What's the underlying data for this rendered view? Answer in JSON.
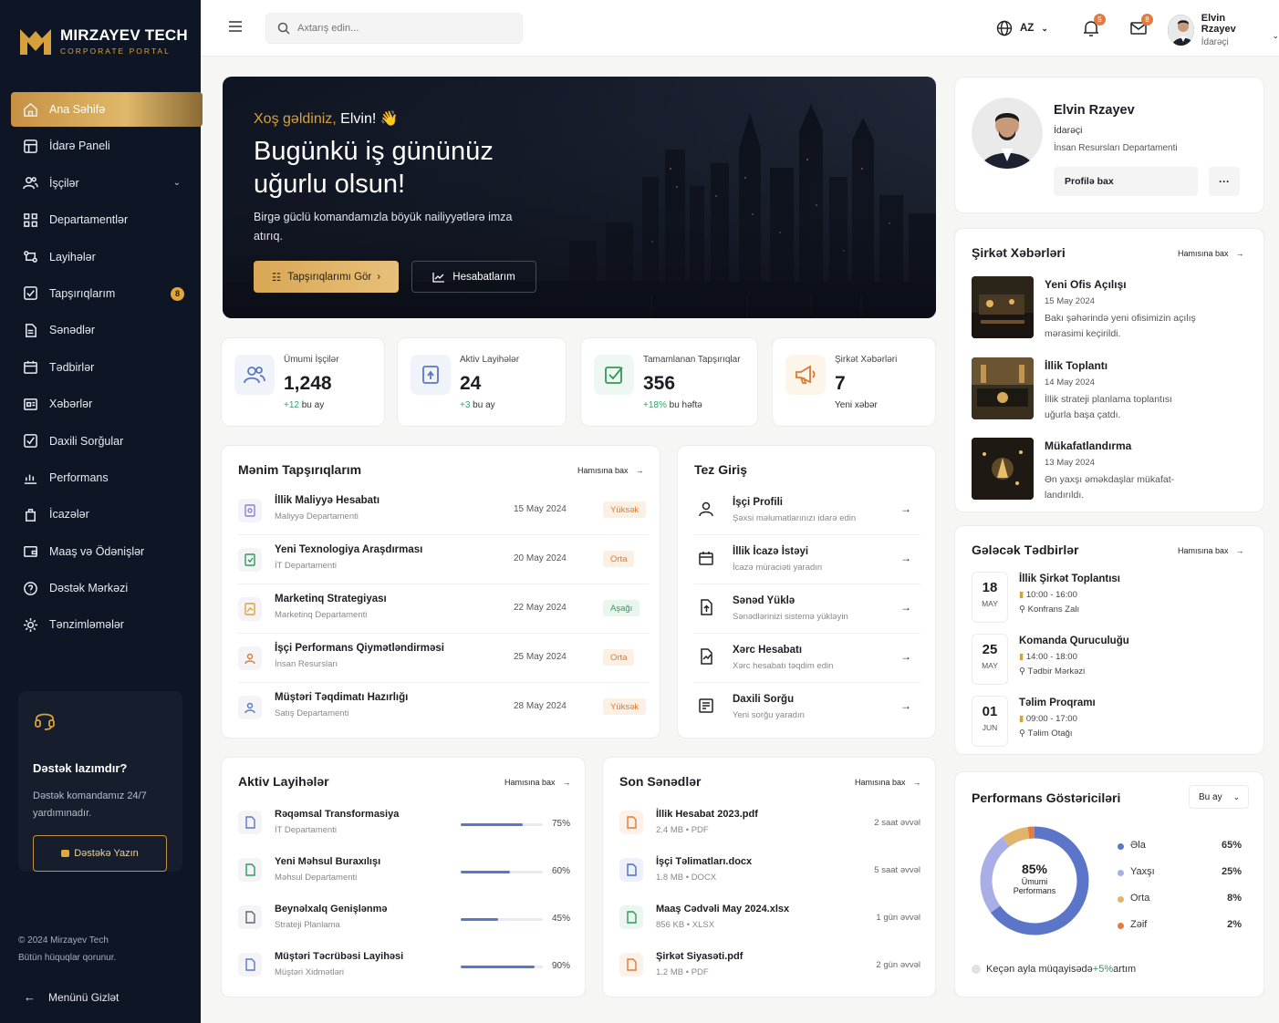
{
  "brand": {
    "title": "MIRZAYEV TECH",
    "subtitle": "CORPORATE PORTAL"
  },
  "sidebar": {
    "items": [
      {
        "label": "Ana Səhifə",
        "icon": "home-icon"
      },
      {
        "label": "İdarə Paneli",
        "icon": "dashboard-icon"
      },
      {
        "label": "İşçilər",
        "icon": "users-icon"
      },
      {
        "label": "Departamentlər",
        "icon": "departments-icon"
      },
      {
        "label": "Layihələr",
        "icon": "projects-icon"
      },
      {
        "label": "Tapşırıqlarım",
        "icon": "tasks-icon",
        "badge": "8"
      },
      {
        "label": "Sənədlər",
        "icon": "documents-icon"
      },
      {
        "label": "Tədbirlər",
        "icon": "calendar-icon"
      },
      {
        "label": "Xəbərlər",
        "icon": "news-icon"
      },
      {
        "label": "Daxili Sorğular",
        "icon": "survey-icon"
      },
      {
        "label": "Performans",
        "icon": "performance-icon"
      },
      {
        "label": "İcazələr",
        "icon": "leave-icon"
      },
      {
        "label": "Maaş və Ödənişlər",
        "icon": "wallet-icon"
      },
      {
        "label": "Dəstək Mərkəzi",
        "icon": "support-icon"
      },
      {
        "label": "Tənzimləmələr",
        "icon": "settings-icon"
      }
    ],
    "support": {
      "title": "Dəstək lazımdır?",
      "text": "Dəstək komandamız 24/7 yardımınadır.",
      "button": "Dəstəkə Yazın"
    },
    "copyright_1": "© 2024 Mirzayev Tech",
    "copyright_2": "Bütün hüquqlar qorunur.",
    "hide_menu": "Menünü Gizlət"
  },
  "topbar": {
    "search_placeholder": "Axtarış edin...",
    "lang": "AZ",
    "notifications_count": "5",
    "messages_count": "8",
    "user_name": "Elvin Rzayev",
    "user_role": "İdarəçi"
  },
  "hero": {
    "greet_prefix": "Xoş gəldiniz, ",
    "greet_name": "Elvin! 👋",
    "title": "Bugünkü iş gününüz uğurlu olsun!",
    "text": "Birgə güclü komandamızla böyük nailiyyətlərə imza atırıq.",
    "btn_tasks": "Tapşırıqlarımı Gör",
    "btn_reports": "Hesabatlarım"
  },
  "stats": [
    {
      "label": "Ümumi İşçilər",
      "value": "1,248",
      "delta": "+12",
      "delta_text": " bu ay"
    },
    {
      "label": "Aktiv Layihələr",
      "value": "24",
      "delta": "+3",
      "delta_text": " bu ay"
    },
    {
      "label": "Tamamlanan Tapşırıqlar",
      "value": "356",
      "delta": "+18%",
      "delta_text": " bu həftə"
    },
    {
      "label": "Şirkət Xəbərləri",
      "value": "7",
      "delta": "",
      "delta_text": "Yeni xəbər"
    }
  ],
  "see_all": "Hamısına bax",
  "tasks": {
    "title": "Mənim Tapşırıqlarım",
    "rows": [
      {
        "title": "İllik Maliyyə Hesabatı",
        "dept": "Maliyyə Departamenti",
        "date": "15 May 2024",
        "priority": "Yüksək"
      },
      {
        "title": "Yeni Texnologiya Araşdırması",
        "dept": "İT Departamenti",
        "date": "20 May 2024",
        "priority": "Orta"
      },
      {
        "title": "Marketinq Strategiyası",
        "dept": "Marketinq Departamenti",
        "date": "22 May 2024",
        "priority": "Aşağı"
      },
      {
        "title": "İşçi Performans Qiymətləndirməsi",
        "dept": "İnsan Resursları",
        "date": "25 May 2024",
        "priority": "Orta"
      },
      {
        "title": "Müştəri Təqdimatı Hazırlığı",
        "dept": "Satış Departamenti",
        "date": "28 May 2024",
        "priority": "Yüksək"
      }
    ]
  },
  "quick": {
    "title": "Tez Giriş",
    "rows": [
      {
        "title": "İşçi Profili",
        "sub": "Şəxsi məlumatlarınızı idarə edin"
      },
      {
        "title": "İllik İcazə İstəyi",
        "sub": "İcazə müraciəti yaradın"
      },
      {
        "title": "Sənəd Yüklə",
        "sub": "Sənədlərinizi sistemə yükləyin"
      },
      {
        "title": "Xərc Hesabatı",
        "sub": "Xərc hesabatı təqdim edin"
      },
      {
        "title": "Daxili Sorğu",
        "sub": "Yeni sorğu yaradın"
      }
    ]
  },
  "projects": {
    "title": "Aktiv Layihələr",
    "rows": [
      {
        "title": "Rəqəmsal Transformasiya",
        "dept": "İT Departamenti",
        "progress": 75,
        "pct": "75%"
      },
      {
        "title": "Yeni Məhsul Buraxılışı",
        "dept": "Məhsul Departamenti",
        "progress": 60,
        "pct": "60%"
      },
      {
        "title": "Beynəlxalq Genişlənmə",
        "dept": "Strateji Planlama",
        "progress": 45,
        "pct": "45%"
      },
      {
        "title": "Müştəri Təcrübəsi Layihəsi",
        "dept": "Müştəri Xidmətləri",
        "progress": 90,
        "pct": "90%"
      }
    ]
  },
  "documents": {
    "title": "Son Sənədlər",
    "rows": [
      {
        "title": "İllik Hesabat 2023.pdf",
        "meta": "2.4 MB • PDF",
        "time": "2 saat əvvəl",
        "color": "#e07a3a"
      },
      {
        "title": "İşçi Təlimatları.docx",
        "meta": "1.8 MB • DOCX",
        "time": "5 saat əvvəl",
        "color": "#4a6cc9"
      },
      {
        "title": "Maaş Cədvəli May 2024.xlsx",
        "meta": "856 KB • XLSX",
        "time": "1 gün əvvəl",
        "color": "#2f9a5a"
      },
      {
        "title": "Şirkət Siyasəti.pdf",
        "meta": "1.2 MB • PDF",
        "time": "2 gün əvvəl",
        "color": "#e07a3a"
      }
    ]
  },
  "profile": {
    "name": "Elvin Rzayev",
    "role": "İdarəçi",
    "dept": "İnsan Resursları Departamenti",
    "button": "Profilə bax",
    "more": "···"
  },
  "news": {
    "title": "Şirkət Xəbərləri",
    "rows": [
      {
        "title": "Yeni Ofis Açılışı",
        "date": "15 May 2024",
        "text": "Bakı şəhərində yeni ofisimizin açılış mərasimi keçirildi."
      },
      {
        "title": "İllik Toplantı",
        "date": "14 May 2024",
        "text": "İllik strateji planlama toplantısı uğurla başa çatdı."
      },
      {
        "title": "Mükafatlandırma",
        "date": "13 May 2024",
        "text": "Ən yaxşı əməkdaşlar mükafat-landırıldı."
      }
    ]
  },
  "events": {
    "title": "Gələcək Tədbirlər",
    "rows": [
      {
        "day": "18",
        "month": "MAY",
        "title": "İllik Şirkət Toplantısı",
        "time": "10:00 - 16:00",
        "place": "Konfrans Zalı"
      },
      {
        "day": "25",
        "month": "MAY",
        "title": "Komanda Quruculuğu",
        "time": "14:00 - 18:00",
        "place": "Tədbir Mərkəzi"
      },
      {
        "day": "01",
        "month": "JUN",
        "title": "Təlim Proqramı",
        "time": "09:00 - 17:00",
        "place": "Təlim Otağı"
      }
    ]
  },
  "performance": {
    "title": "Performans Göstəriciləri",
    "period": "Bu ay",
    "center_value": "85%",
    "center_label_1": "Ümumi",
    "center_label_2": "Performans",
    "footer_prefix": "Keçən ayla müqayisədə ",
    "footer_delta": "+5%",
    "footer_suffix": " artım"
  },
  "chart_data": {
    "type": "pie",
    "categories": [
      "Əla",
      "Yaxşı",
      "Orta",
      "Zəif"
    ],
    "values": [
      65,
      25,
      8,
      2
    ],
    "value_labels": [
      "65%",
      "25%",
      "8%",
      "2%"
    ],
    "colors": [
      "#5b76c9",
      "#a9aee6",
      "#e2b46a",
      "#e57a3e"
    ]
  },
  "priority_colors": {
    "Yüksək": "#e0792f",
    "Orta": "#e0792f",
    "Aşağı": "#2f9a5a"
  }
}
